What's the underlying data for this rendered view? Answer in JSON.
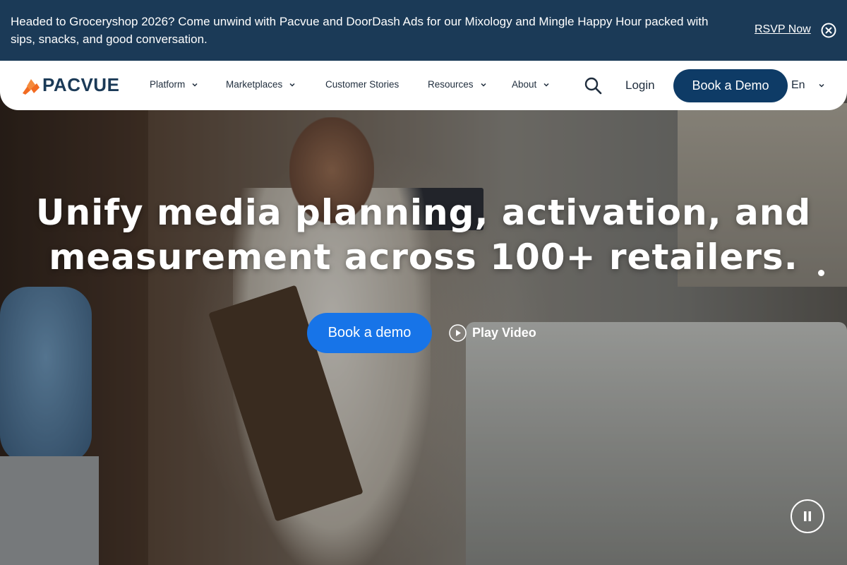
{
  "announcement": {
    "text": "Headed to Groceryshop 2026? Come unwind with Pacvue and DoorDash Ads for our Mixology and Mingle Happy Hour packed with sips, snacks, and good conversation.",
    "link_label": "RSVP Now",
    "close_icon": "close-circle-icon",
    "background": "#1b3a57"
  },
  "nav": {
    "logo_text": "PACVUE",
    "items": [
      {
        "label": "Platform",
        "dropdown": true
      },
      {
        "label": "Marketplaces",
        "dropdown": true
      },
      {
        "label": "Customer Stories",
        "dropdown": false
      },
      {
        "label": "Resources",
        "dropdown": true
      },
      {
        "label": "About",
        "dropdown": true
      }
    ],
    "search_icon": "search-icon",
    "login_label": "Login",
    "cta_label": "Book a Demo",
    "language": "En",
    "cta_color": "#0e3b66",
    "brand_accent": "#f26b21"
  },
  "hero": {
    "headline_line1": "Unify media planning, activation, and",
    "headline_line2": "measurement across 100+ retailers.",
    "primary_cta": "Book a demo",
    "secondary_cta": "Play Video",
    "primary_color": "#1774e8",
    "pause_icon": "pause-icon",
    "play_icon": "play-circle-icon"
  }
}
